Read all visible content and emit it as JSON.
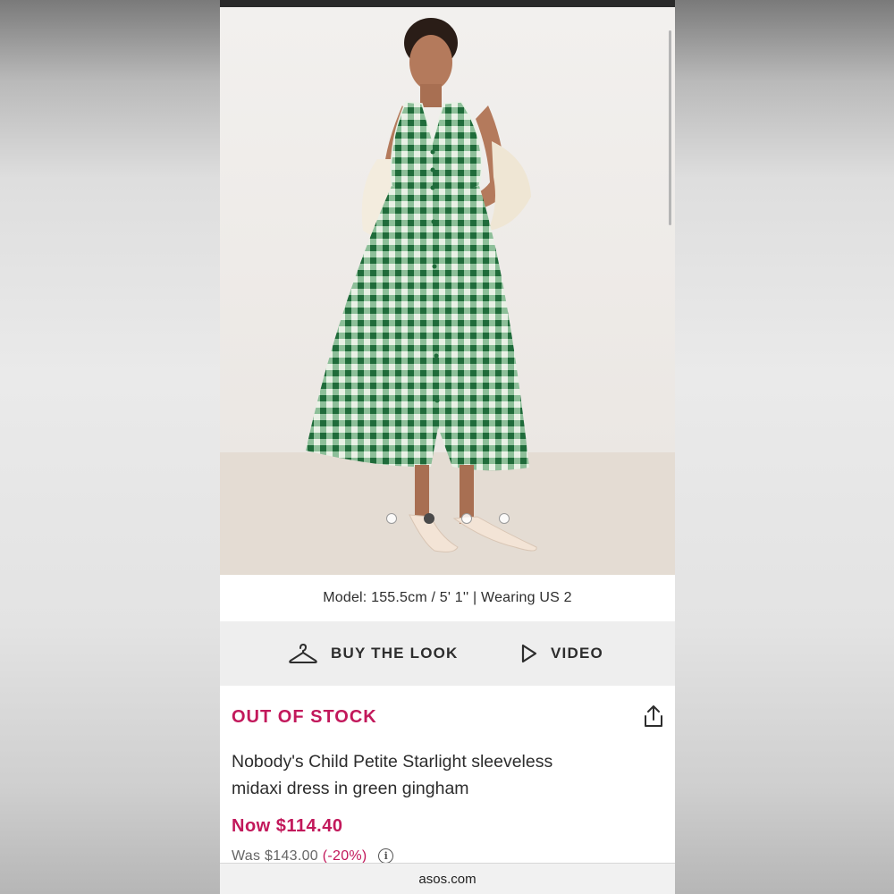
{
  "gallery": {
    "active_index": 1,
    "dots": [
      "image-1",
      "image-2",
      "image-3",
      "image-4"
    ]
  },
  "model_info": "Model: 155.5cm / 5' 1'' | Wearing US 2",
  "actions": {
    "buy_the_look": {
      "label": "BUY THE LOOK",
      "icon": "hanger-icon"
    },
    "video": {
      "label": "VIDEO",
      "icon": "play-icon"
    }
  },
  "product": {
    "stock_status": "OUT OF STOCK",
    "title_line1": "Nobody's Child Petite Starlight sleeveless",
    "title_line2": "midaxi dress in green gingham",
    "now_price": "Now $114.40",
    "was_price": "Was $143.00",
    "discount": "(-20%)",
    "info_icon": "info-icon",
    "share_icon": "share-icon"
  },
  "browser": {
    "url": "asos.com"
  },
  "colors": {
    "accent": "#c2185b",
    "dress_green": "#2f7a45",
    "action_bar": "#eeeeee"
  }
}
